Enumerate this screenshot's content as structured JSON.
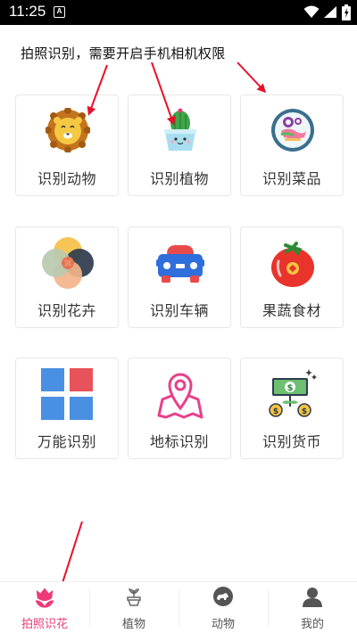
{
  "status_bar": {
    "time": "11:25",
    "notification_icon": "A"
  },
  "hint_text": "拍照识别，需要开启手机相机权限",
  "grid": [
    {
      "label": "识别动物",
      "icon": "lion-icon"
    },
    {
      "label": "识别植物",
      "icon": "cactus-icon"
    },
    {
      "label": "识别菜品",
      "icon": "dish-icon"
    },
    {
      "label": "识别花卉",
      "icon": "flower-icon"
    },
    {
      "label": "识别车辆",
      "icon": "car-icon"
    },
    {
      "label": "果蔬食材",
      "icon": "tomato-icon"
    },
    {
      "label": "万能识别",
      "icon": "squares-icon"
    },
    {
      "label": "地标识别",
      "icon": "map-pin-icon"
    },
    {
      "label": "识别货币",
      "icon": "money-icon"
    }
  ],
  "tabs": [
    {
      "label": "拍照识花",
      "icon": "tulip-icon",
      "active": true
    },
    {
      "label": "植物",
      "icon": "potted-plant-icon"
    },
    {
      "label": "动物",
      "icon": "animal-icon"
    },
    {
      "label": "我的",
      "icon": "user-icon"
    }
  ],
  "colors": {
    "accent": "#ee3a78",
    "annotation_arrow": "#e8102a"
  }
}
